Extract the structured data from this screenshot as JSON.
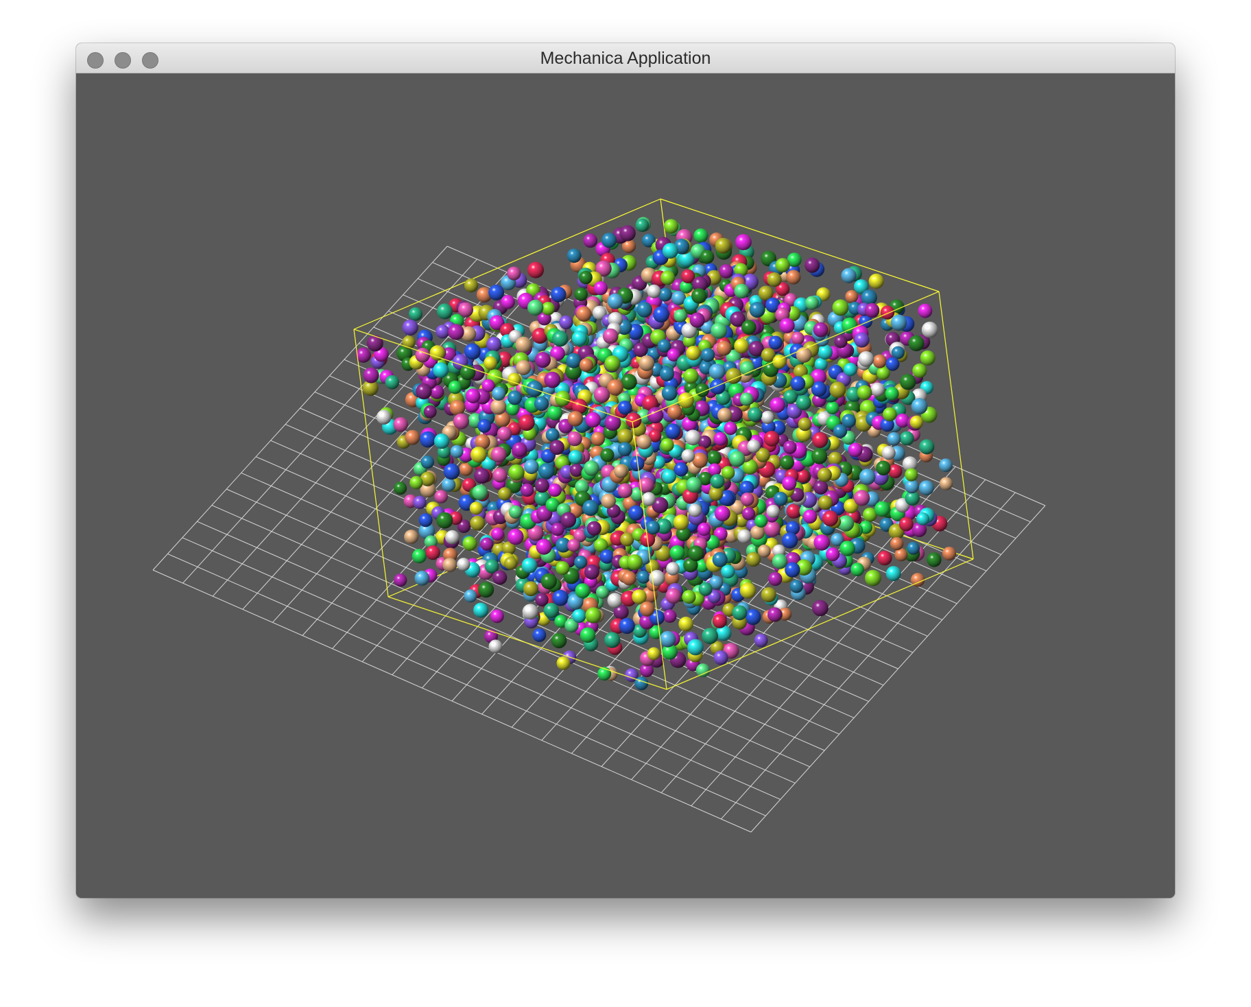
{
  "window": {
    "title": "Mechanica Application",
    "controls": [
      {
        "name": "close",
        "icon": "window-close-icon"
      },
      {
        "name": "minimize",
        "icon": "window-minimize-icon"
      },
      {
        "name": "zoom",
        "icon": "window-zoom-icon"
      }
    ],
    "control_color": "#8c8c8c"
  },
  "viewport": {
    "background_color": "#595959",
    "grid_color": "#d8d8d8",
    "box_color": "#ffff33",
    "particle_palette": [
      "#ff33ff",
      "#33ff66",
      "#3366ff",
      "#ffff33",
      "#33ffff",
      "#ff3366",
      "#ff9966",
      "#99ff33",
      "#9966ff",
      "#66ccff",
      "#ffcc99",
      "#33cc99",
      "#cc33cc",
      "#ff66cc",
      "#66ff99",
      "#cccc33",
      "#3399cc",
      "#ffffff",
      "#993399",
      "#339933"
    ]
  }
}
